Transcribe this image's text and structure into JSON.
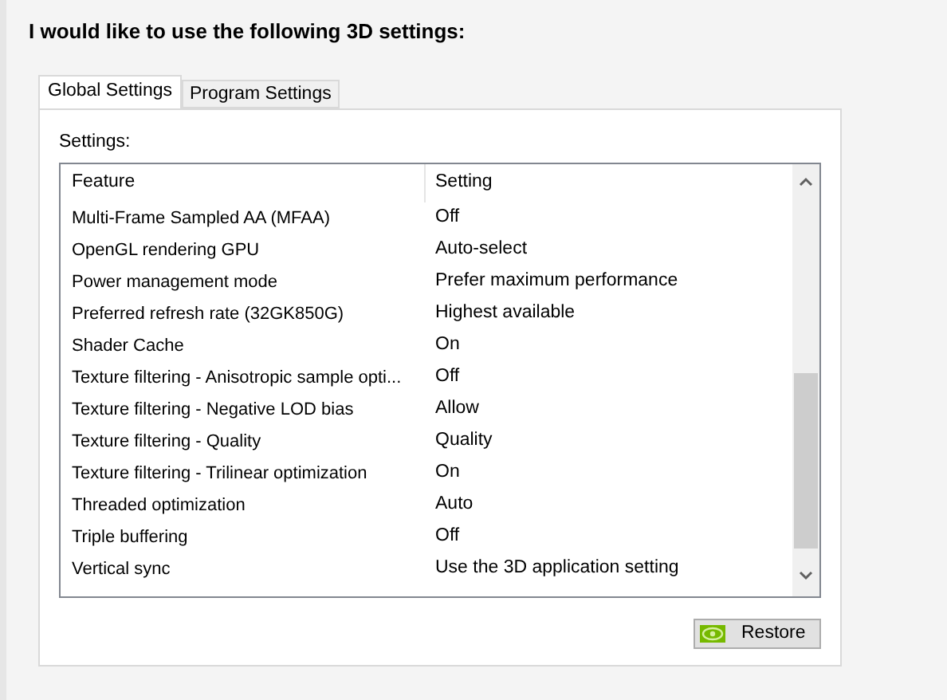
{
  "heading": "I would like to use the following 3D settings:",
  "tabs": [
    {
      "label": "Global Settings",
      "selected": true
    },
    {
      "label": "Program Settings",
      "selected": false
    }
  ],
  "settings_label": "Settings:",
  "table": {
    "columns": [
      "Feature",
      "Setting"
    ],
    "rows": [
      {
        "feature": "Multi-Frame Sampled AA (MFAA)",
        "setting": "Off"
      },
      {
        "feature": "OpenGL rendering GPU",
        "setting": "Auto-select"
      },
      {
        "feature": "Power management mode",
        "setting": "Prefer maximum performance"
      },
      {
        "feature": "Preferred refresh rate (32GK850G)",
        "setting": "Highest available"
      },
      {
        "feature": "Shader Cache",
        "setting": "On"
      },
      {
        "feature": "Texture filtering - Anisotropic sample opti...",
        "setting": "Off"
      },
      {
        "feature": "Texture filtering - Negative LOD bias",
        "setting": "Allow"
      },
      {
        "feature": "Texture filtering - Quality",
        "setting": "Quality"
      },
      {
        "feature": "Texture filtering - Trilinear optimization",
        "setting": "On"
      },
      {
        "feature": "Threaded optimization",
        "setting": "Auto"
      },
      {
        "feature": "Triple buffering",
        "setting": "Off"
      },
      {
        "feature": "Vertical sync",
        "setting": "Use the 3D application setting"
      }
    ]
  },
  "restore_button": "Restore"
}
